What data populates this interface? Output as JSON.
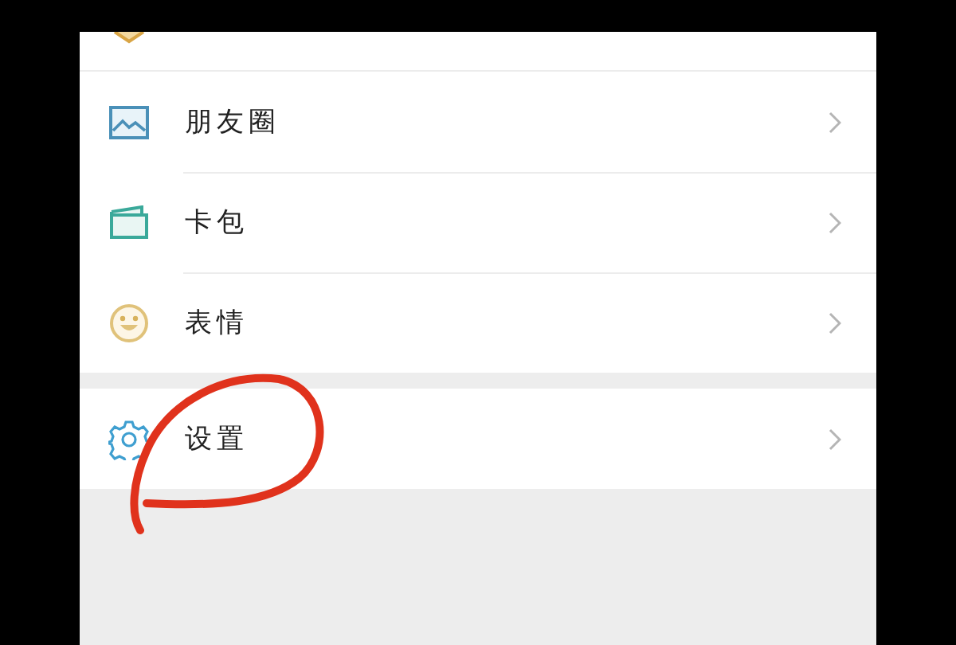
{
  "menu_groups": [
    {
      "items": [
        {
          "label": "朋友圈"
        },
        {
          "label": "卡包"
        },
        {
          "label": "表情"
        }
      ]
    },
    {
      "items": [
        {
          "label": "设置"
        }
      ]
    }
  ]
}
